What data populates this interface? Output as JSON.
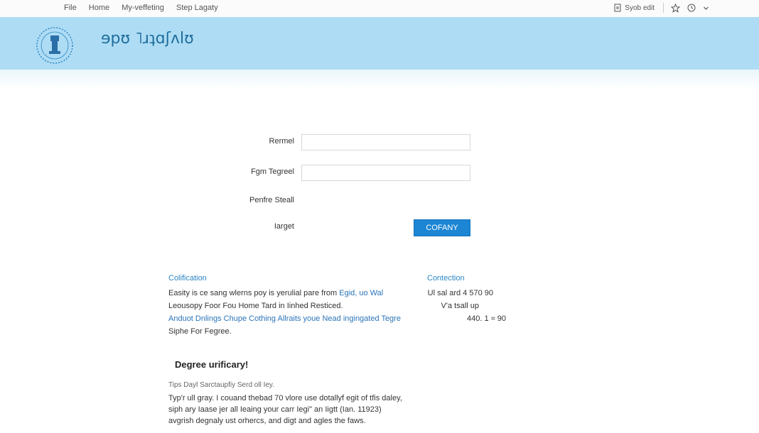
{
  "topnav": [
    "File",
    "Home",
    "My-veffeting",
    "Step Lagaty"
  ],
  "topright": {
    "file_label": "Syob edit"
  },
  "icons": [
    "file-icon",
    "star-icon",
    "clock-icon",
    "chevron-down-icon",
    "emblem-icon"
  ],
  "banner": {
    "title": "ɘpʊ ˥ɹʇɑʃʌlʊ"
  },
  "form": {
    "field1_label": "Rermel",
    "field1_value": "",
    "field2_label": "Fgm Tegreel",
    "field2_value": "",
    "static_label": "Penfre Steall",
    "button_row_label": "Iarget",
    "button_label": "COFANY"
  },
  "left_section": {
    "heading": "Colification",
    "line1_prefix": "Easity is ce sang wlerns poy is yerulial pare from ",
    "line1_link": "Egid, uo Wal",
    "line2": "Leousopy Foor Fou Home Tard in Iinhed Resticed.",
    "line3": "Anduot Dnlings Chupe Cothing Allraits youe Nead ingingated Tegre",
    "line4": "Siphe For Fegree."
  },
  "right_section": {
    "heading": "Contection",
    "line1": "Ul sal ard 4 570 90",
    "line2": "V'a tsall up",
    "line3": "440. 1 ≈ 90"
  },
  "degree": {
    "title": "Degree urificary!",
    "subtitle": "Tips Dayl Sarctaupfiy Serd oll Iey.",
    "line1": "Typ'r ull gray. I couand thebad 70 vlore use dotallyf egit of tfis daley,",
    "line2": "siph ary Iaase jer all Ieaing your carr Iegi\" an Iigtt (Ian. 11923)",
    "line3": "avgrish degnaly ust orhercs, and digt and agles the faws."
  },
  "colors": {
    "banner": "#aedcf4",
    "accent": "#1c86d4",
    "link": "#2b74b8"
  }
}
